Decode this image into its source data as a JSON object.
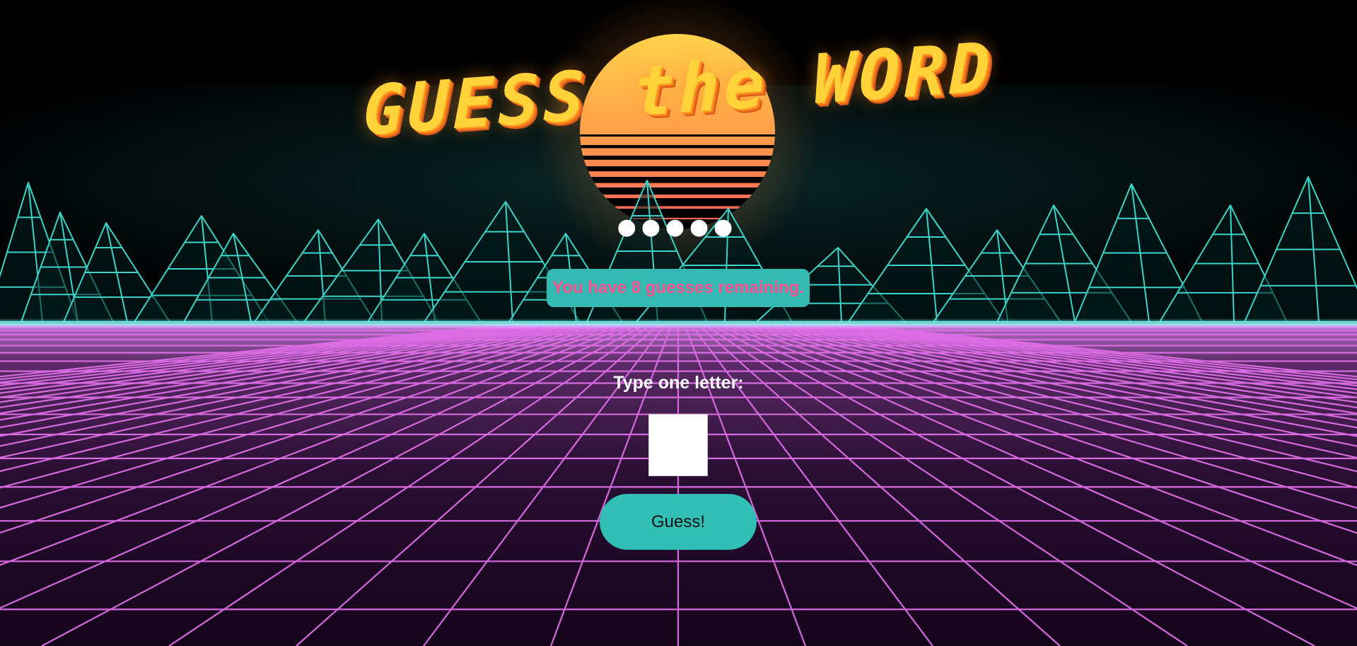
{
  "title": "GUESS the WORD",
  "word_progress": "●●●●●",
  "remaining_text": "You have 8 guesses remaining.",
  "prompt_label": "Type one letter:",
  "letter_input": {
    "value": "",
    "placeholder": ""
  },
  "guess_button_label": "Guess!",
  "colors": {
    "teal": "#35b9b3",
    "pink_text": "#ff4f8f",
    "grid_magenta": "#e06ee8",
    "sun_top": "#ffd24a",
    "sun_bottom": "#ff5d5d",
    "mountain_teal": "#3cd3c8"
  }
}
